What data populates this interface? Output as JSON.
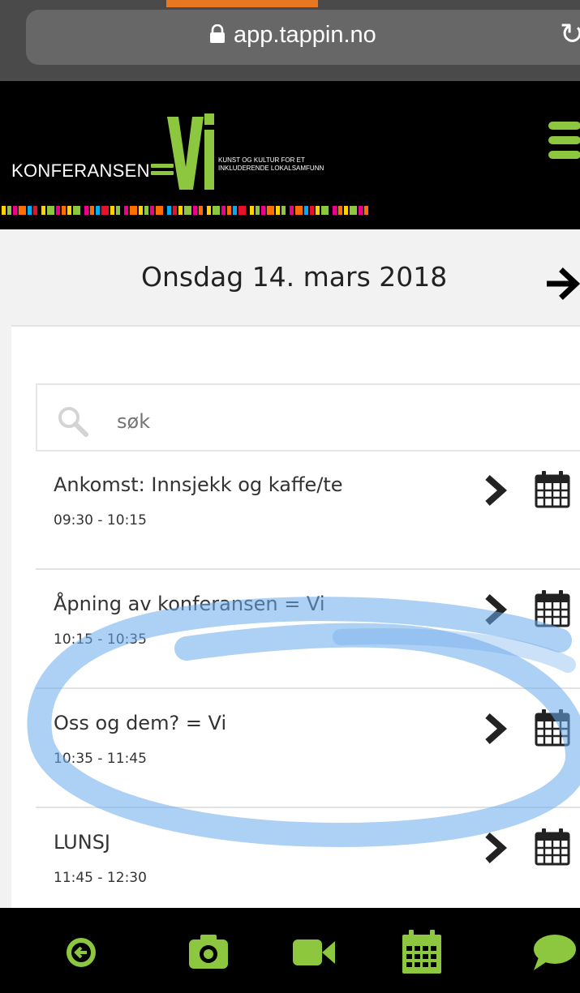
{
  "browser": {
    "url": "app.tappin.no",
    "icons": [
      "lock-icon",
      "reload-icon"
    ],
    "accent": "#e87722"
  },
  "header": {
    "logo_left": "KONFERANSEN",
    "logo_vi": "Vi",
    "logo_tagline_1": "KUNST OG KULTUR FOR ET",
    "logo_tagline_2": "INKLUDERENDE LOKALSAMFUNN",
    "menu_icon": "hamburger-menu-icon",
    "brand_color": "#8dc63f"
  },
  "date_bar": {
    "date": "Onsdag 14. mars 2018",
    "next_icon": "arrow-right-icon"
  },
  "search": {
    "placeholder": "søk",
    "value": ""
  },
  "events": [
    {
      "title": "Ankomst: Innsjekk og kaffe/te",
      "time": "09:30 - 10:15"
    },
    {
      "title": "Åpning av konferansen = Vi",
      "time": "10:15 - 10:35"
    },
    {
      "title": "Oss og dem? = Vi",
      "time": "10:35 - 11:45"
    },
    {
      "title": "LUNSJ",
      "time": "11:45 - 12:30"
    }
  ],
  "annotation": {
    "shape": "freehand-ellipse",
    "color": "#6aa9ec",
    "circled_event": "Oss og dem? = Vi"
  },
  "bottom_nav": {
    "items": [
      "back-icon",
      "camera-icon",
      "video-icon",
      "calendar-icon",
      "chat-icon"
    ],
    "icon_color": "#8dc63f"
  }
}
